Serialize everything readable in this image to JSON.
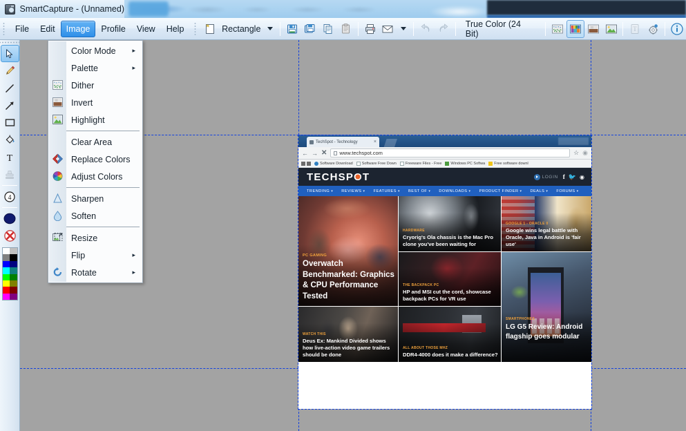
{
  "window": {
    "title": "SmartCapture - (Unnamed)",
    "app_icon": "camera-icon"
  },
  "menubar": {
    "items": [
      {
        "label": "File",
        "active": false
      },
      {
        "label": "Edit",
        "active": false
      },
      {
        "label": "Image",
        "active": true
      },
      {
        "label": "Profile",
        "active": false
      },
      {
        "label": "View",
        "active": false
      },
      {
        "label": "Help",
        "active": false
      }
    ]
  },
  "toolbar": {
    "capture_mode_label": "Rectangle",
    "capture_mode_icon": "rectangle-capture-icon",
    "capture_mode_caret": "▾",
    "save_icon": "save-floppy-icon",
    "save_as_icon": "save-multiple-icon",
    "copy_icon": "copy-icon",
    "paste_icon": "paste-icon",
    "print_icon": "printer-icon",
    "mail_icon": "envelope-icon",
    "mail_caret": "▾",
    "undo_icon": "undo-arrow-icon",
    "redo_icon": "redo-arrow-icon",
    "color_depth_label": "True Color (24 Bit)",
    "dither_icon": "dither-image-icon",
    "color_mode_icon": "color-palette-image-icon",
    "invert_icon": "invert-image-icon",
    "highlight_icon": "highlight-image-icon",
    "text_icon": "text-tool-icon",
    "settings_icon": "gear-settings-icon",
    "info_icon": "info-circle-icon"
  },
  "image_menu": {
    "items": [
      {
        "label": "Color Mode",
        "icon": "",
        "submenu": true,
        "separator_after": false
      },
      {
        "label": "Palette",
        "icon": "",
        "submenu": true,
        "separator_after": false
      },
      {
        "label": "Dither",
        "icon": "dither-icon",
        "submenu": false,
        "separator_after": false
      },
      {
        "label": "Invert",
        "icon": "invert-icon",
        "submenu": false,
        "separator_after": false
      },
      {
        "label": "Highlight",
        "icon": "highlight-icon",
        "submenu": false,
        "separator_after": true
      },
      {
        "label": "Clear Area",
        "icon": "",
        "submenu": false,
        "separator_after": false
      },
      {
        "label": "Replace Colors",
        "icon": "replace-colors-icon",
        "submenu": false,
        "separator_after": false
      },
      {
        "label": "Adjust Colors",
        "icon": "adjust-colors-icon",
        "submenu": false,
        "separator_after": true
      },
      {
        "label": "Sharpen",
        "icon": "sharpen-icon",
        "submenu": false,
        "separator_after": false
      },
      {
        "label": "Soften",
        "icon": "soften-icon",
        "submenu": false,
        "separator_after": true
      },
      {
        "label": "Resize",
        "icon": "resize-icon",
        "submenu": false,
        "separator_after": false
      },
      {
        "label": "Flip",
        "icon": "",
        "submenu": true,
        "separator_after": false
      },
      {
        "label": "Rotate",
        "icon": "rotate-icon",
        "submenu": true,
        "separator_after": false
      }
    ],
    "submenu_arrow": "▸"
  },
  "tool_palette": {
    "tools": [
      {
        "name": "select-arrow-tool",
        "selected": true
      },
      {
        "name": "pencil-tool",
        "selected": false
      },
      {
        "name": "line-tool",
        "selected": false
      },
      {
        "name": "arrow-tool",
        "selected": false
      },
      {
        "name": "rectangle-tool",
        "selected": false
      },
      {
        "name": "fill-bucket-tool",
        "selected": false
      },
      {
        "name": "text-tool",
        "selected": false
      },
      {
        "name": "stamp-tool",
        "selected": false
      },
      {
        "name": "numbering-tool",
        "selected": false,
        "label": "4"
      },
      {
        "name": "ellipse-filled-tool",
        "selected": false
      },
      {
        "name": "cancel-tool",
        "selected": false
      }
    ],
    "colors": [
      "#ffffff",
      "#c0c0c0",
      "#808080",
      "#000000",
      "#0000ff",
      "#000080",
      "#00ffff",
      "#008080",
      "#00ff00",
      "#008000",
      "#ffff00",
      "#808000",
      "#ff0000",
      "#800000",
      "#ff00ff",
      "#800080"
    ]
  },
  "canvas": {
    "background_color": "#a3a3a3",
    "guide_color": "#1040e0"
  },
  "screenshot": {
    "browser": {
      "tab_title": "TechSpot - Technology",
      "tab_close": "×",
      "back_icon": "back-arrow-icon",
      "forward_icon": "forward-arrow-icon",
      "stop_icon": "stop-x-icon",
      "url": "www.techspot.com",
      "star_icon": "bookmark-star-icon",
      "menu_icon": "browser-menu-icon",
      "bookmarks": [
        {
          "label": "Software Download",
          "color": "#e8e8e8"
        },
        {
          "label": "Software Free Down",
          "color": "#ffffff"
        },
        {
          "label": "Freeware Files - Free",
          "color": "#ffffff"
        },
        {
          "label": "Windows PC Softwa",
          "color": "#4c9c3f"
        },
        {
          "label": "Free software downl",
          "color": "#f0c419"
        }
      ]
    },
    "site": {
      "logo": "TECHSP",
      "logo_tail": "T",
      "login_label": "LOGIN",
      "social": [
        "f",
        "🐦",
        "≈"
      ],
      "nav": [
        "TRENDING",
        "REVIEWS",
        "FEATURES",
        "BEST OF",
        "DOWNLOADS",
        "PRODUCT FINDER",
        "DEALS",
        "FORUMS"
      ],
      "nav_caret": "▾",
      "cards": [
        {
          "id": "card-overwatch",
          "kicker": "PC GAMING",
          "title": "Overwatch Benchmarked: Graphics & CPU Performance Tested"
        },
        {
          "id": "card-cryorig",
          "kicker": "HARDWARE",
          "title": "Cryorig's Ola chassis is the Mac Pro clone you've been waiting for"
        },
        {
          "id": "card-google-oracle",
          "kicker": "GOOGLE 1 - ORACLE 0",
          "title": "Google wins legal battle with Oracle, Java in Android is 'fair use'"
        },
        {
          "id": "card-backpack-pc",
          "kicker": "THE BACKPACK PC",
          "title": "HP and MSI cut the cord, showcase backpack PCs for VR use"
        },
        {
          "id": "card-lg-g5",
          "kicker": "SMARTPHONES",
          "title": "LG G5 Review: Android flagship goes modular"
        },
        {
          "id": "card-deus-ex",
          "kicker": "WATCH THIS",
          "title": "Deus Ex: Mankind Divided shows how live-action video game trailers should be done"
        },
        {
          "id": "card-ddr4",
          "kicker": "ALL ABOUT THOSE MHZ",
          "title": "DDR4-4000 does it make a difference?"
        }
      ]
    }
  }
}
